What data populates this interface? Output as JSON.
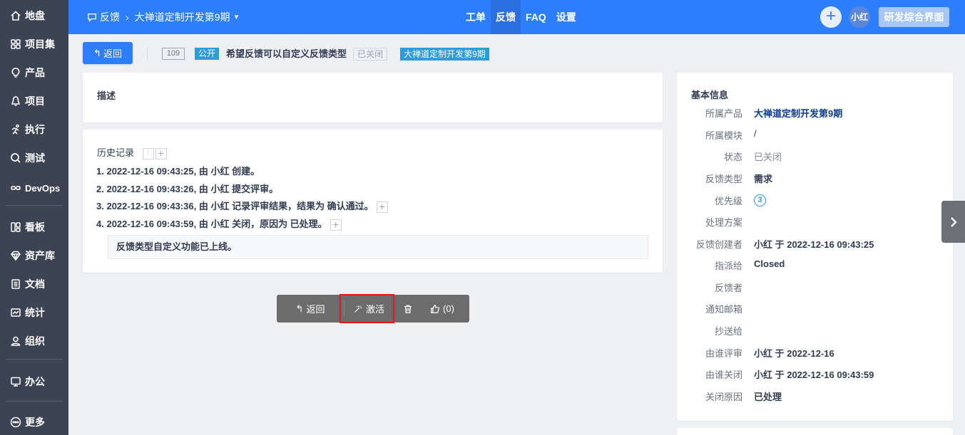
{
  "sidebar": {
    "items": [
      {
        "label": "地盘",
        "icon": "home-icon"
      },
      {
        "label": "项目集",
        "icon": "grid-icon"
      },
      {
        "label": "产品",
        "icon": "lightbulb-icon"
      },
      {
        "label": "项目",
        "icon": "bell-icon"
      },
      {
        "label": "执行",
        "icon": "run-icon"
      },
      {
        "label": "测试",
        "icon": "search-icon"
      },
      {
        "label": "DevOps",
        "icon": "infinity-icon"
      },
      {
        "label": "看板",
        "icon": "kanban-icon"
      },
      {
        "label": "资产库",
        "icon": "diamond-icon"
      },
      {
        "label": "文档",
        "icon": "document-icon"
      },
      {
        "label": "统计",
        "icon": "chart-icon"
      },
      {
        "label": "组织",
        "icon": "user-icon"
      },
      {
        "label": "办公",
        "icon": "office-icon"
      },
      {
        "label": "更多",
        "icon": "more-icon"
      }
    ]
  },
  "topbar": {
    "module": "反馈",
    "product": "大禅道定制开发第9期",
    "tabs": [
      "工单",
      "反馈",
      "FAQ",
      "设置"
    ],
    "active_tab": "反馈",
    "avatar": "小红",
    "dev_button": "研发综合界面",
    "accent": "#2e7fff"
  },
  "header": {
    "back": "返回",
    "id": "109",
    "visibility": "公开",
    "title": "希望反馈可以自定义反馈类型",
    "status": "已关闭",
    "product_tag": "大禅道定制开发第9期"
  },
  "description": {
    "title": "描述"
  },
  "history": {
    "title": "历史记录",
    "entries": [
      {
        "num": "1.",
        "time": "2022-12-16 09:43:25,",
        "text": " 由 小红 创建。"
      },
      {
        "num": "2.",
        "time": "2022-12-16 09:43:26,",
        "text": " 由 小红 提交评审。"
      },
      {
        "num": "3.",
        "time": "2022-12-16 09:43:36,",
        "text": " 由 小红 记录评审结果，结果为 确认通过。"
      },
      {
        "num": "4.",
        "time": "2022-12-16 09:43:59,",
        "text": " 由 小红 关闭，原因为 已处理。"
      }
    ],
    "comment": "反馈类型自定义功能已上线。"
  },
  "actions": {
    "back": "返回",
    "activate": "激活",
    "like": "(0)"
  },
  "info": {
    "title": "基本信息",
    "rows": [
      {
        "label": "所属产品",
        "value": "大禅道定制开发第9期"
      },
      {
        "label": "所属模块",
        "value": "/"
      },
      {
        "label": "状态",
        "value": "已关闭"
      },
      {
        "label": "反馈类型",
        "value": "需求"
      },
      {
        "label": "优先级",
        "value": "3"
      },
      {
        "label": "处理方案",
        "value": ""
      },
      {
        "label": "反馈创建者",
        "value": "小红 于 2022-12-16 09:43:25"
      },
      {
        "label": "指派给",
        "value": "Closed"
      },
      {
        "label": "反馈者",
        "value": ""
      },
      {
        "label": "通知邮箱",
        "value": ""
      },
      {
        "label": "抄送给",
        "value": ""
      },
      {
        "label": "由谁评审",
        "value": "小红 于 2022-12-16"
      },
      {
        "label": "由谁关闭",
        "value": "小红 于 2022-12-16 09:43:59"
      },
      {
        "label": "关闭原因",
        "value": "已处理"
      }
    ]
  }
}
